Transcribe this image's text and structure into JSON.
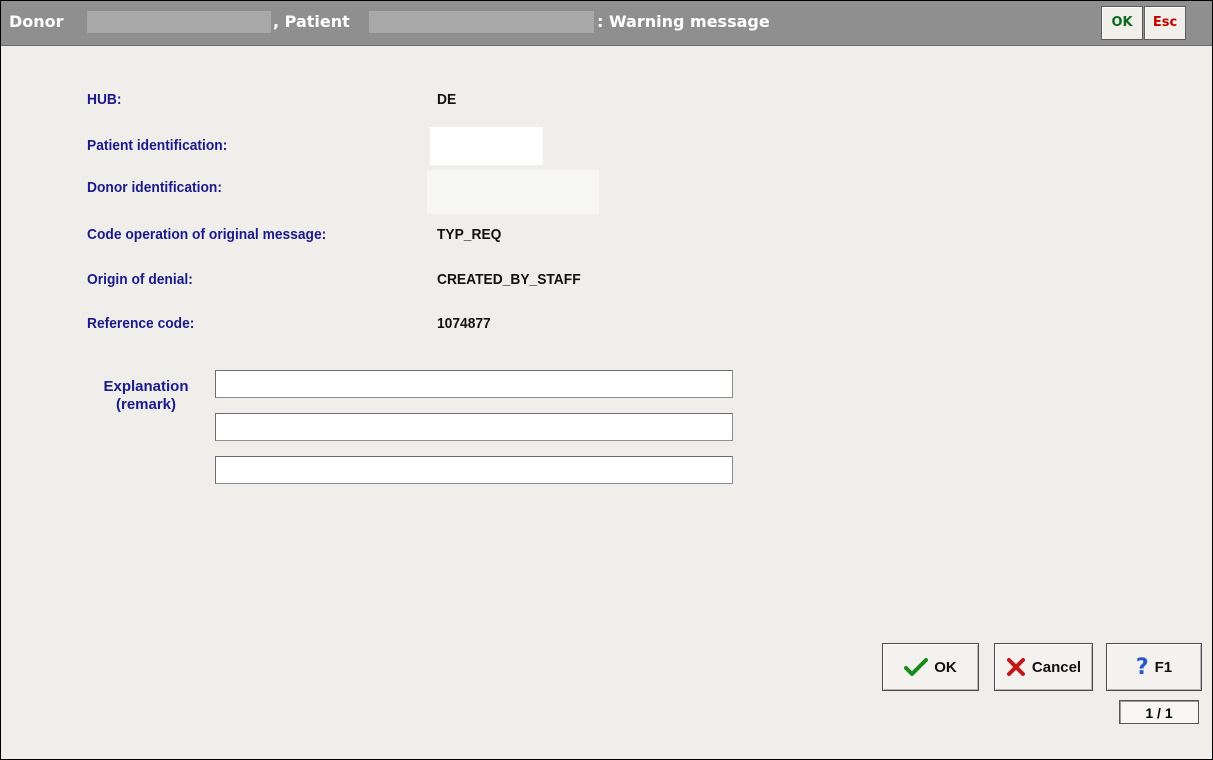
{
  "window": {
    "title_donor": "Donor",
    "title_patient": ", Patient",
    "title_suffix": ": Warning message",
    "tb_ok": "OK",
    "tb_esc": "Esc"
  },
  "fields": {
    "hub_label": "HUB:",
    "hub_value": "DE",
    "patient_id_label": "Patient identification:",
    "donor_id_label": "Donor identification:",
    "code_op_label": "Code operation of original message:",
    "code_op_value": "TYP_REQ",
    "origin_label": "Origin of denial:",
    "origin_value": "CREATED_BY_STAFF",
    "ref_label": "Reference code:",
    "ref_value": "1074877"
  },
  "explanation": {
    "label_line1": "Explanation",
    "label_line2": "(remark)",
    "line1": "",
    "line2": "",
    "line3": ""
  },
  "buttons": {
    "ok": "OK",
    "cancel": "Cancel",
    "help": "F1"
  },
  "pager": "1 / 1",
  "colors": {
    "label": "#1a1a8c",
    "titlebar": "#8f8f8f",
    "ok_green": "#0b6b1c",
    "esc_red": "#c20000"
  }
}
